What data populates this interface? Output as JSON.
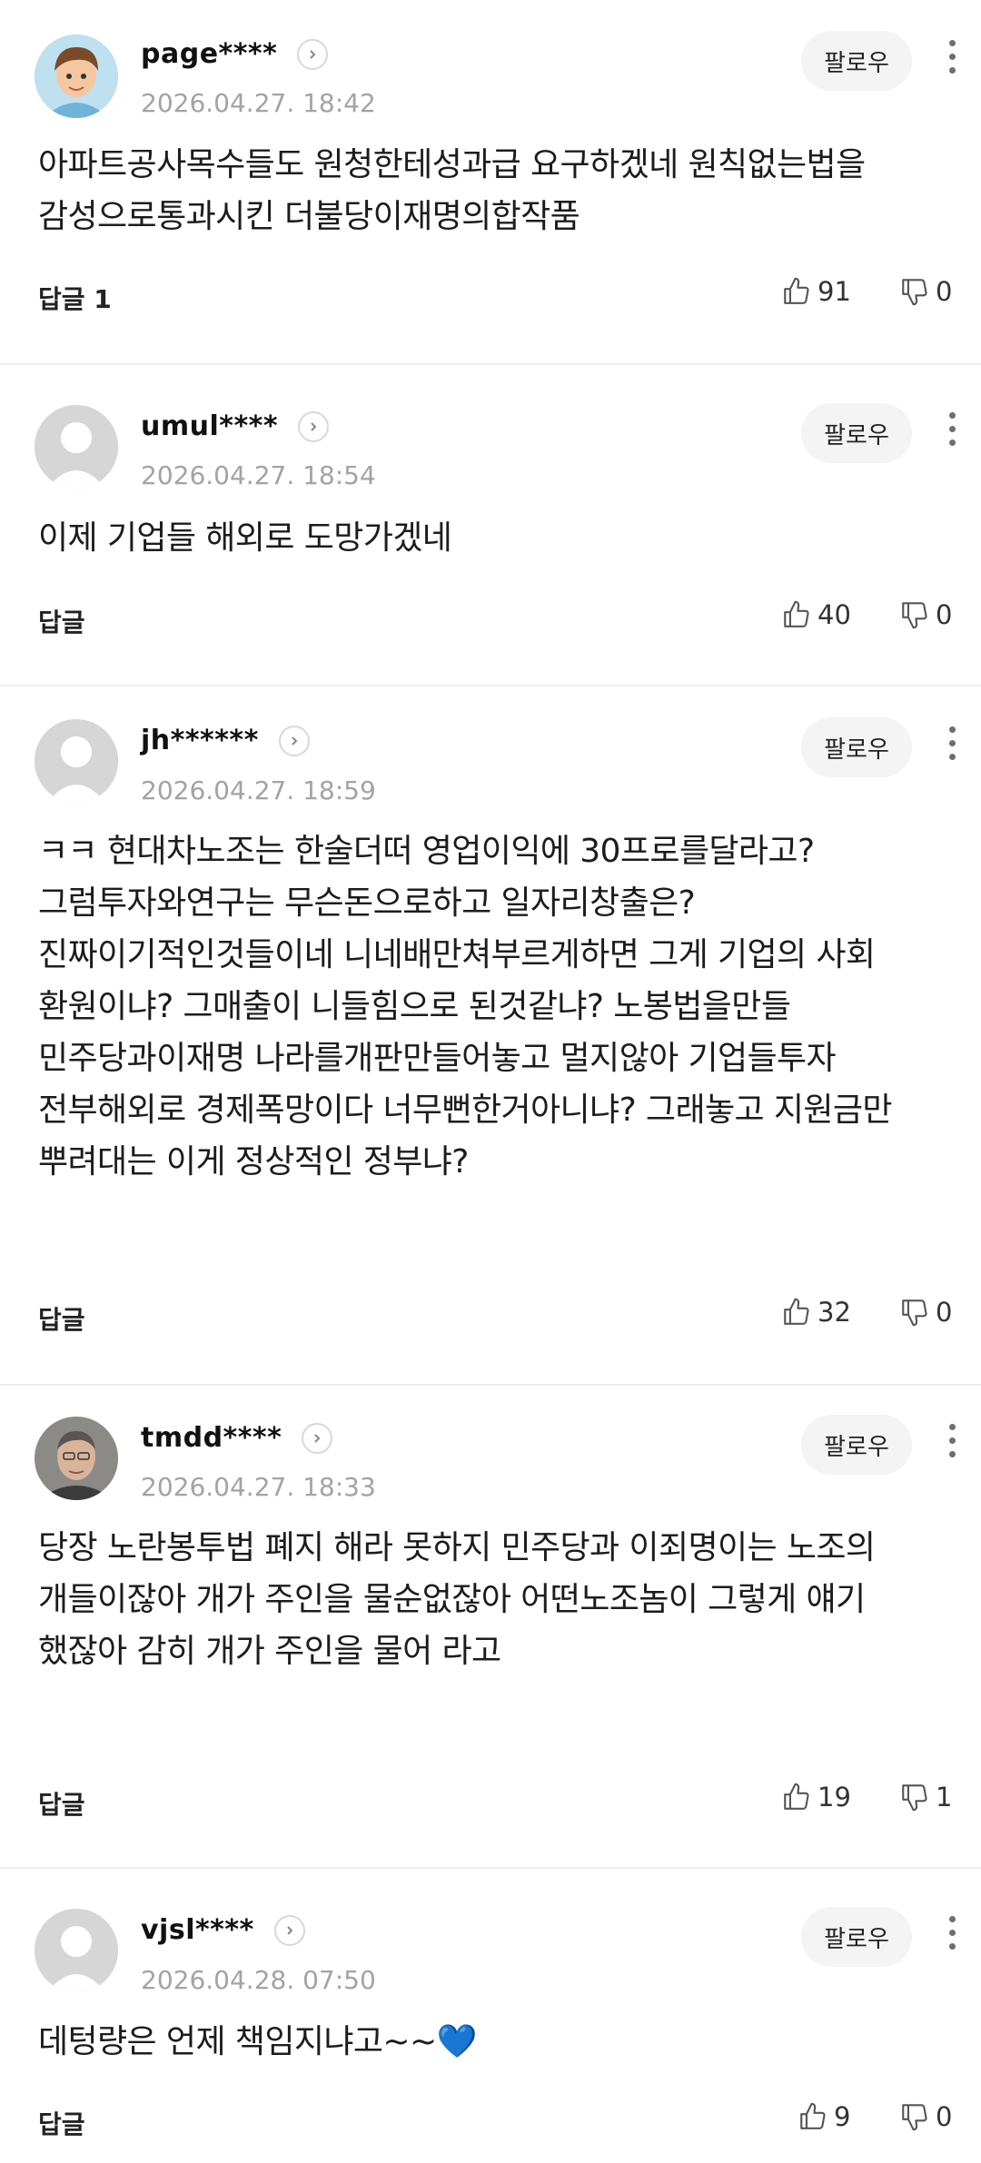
{
  "follow_label": "팔로우",
  "comments": [
    {
      "nickname": "page****",
      "date": "2026.04.27. 18:42",
      "text": "아파트공사목수들도 원청한테성과급 요구하겠네 원칙없는법을 감성으로통과시킨 더불당이재명의합작품",
      "reply_label": "답글 1",
      "likes": "91",
      "dislikes": "0",
      "avatar": "cartoon-avatar"
    },
    {
      "nickname": "umul****",
      "date": "2026.04.27. 18:54",
      "text": "이제 기업들 해외로 도망가겠네",
      "reply_label": "답글",
      "likes": "40",
      "dislikes": "0",
      "avatar": "default-avatar"
    },
    {
      "nickname": "jh******",
      "date": "2026.04.27. 18:59",
      "text": "ㅋㅋ 현대차노조는 한술더떠 영업이익에 30프로를달라고? 그럼투자와연구는 무슨돈으로하고 일자리창출은? 진짜이기적인것들이네 니네배만쳐부르게하면 그게 기업의 사회 환원이냐? 그매출이 니들힘으로 된것같냐? 노봉법을만들 민주당과이재명 나라를개판만들어놓고 멀지않아 기업들투자 전부해외로 경제폭망이다 너무뻔한거아니냐? 그래놓고 지원금만 뿌려대는 이게 정상적인 정부냐?",
      "reply_label": "답글",
      "likes": "32",
      "dislikes": "0",
      "avatar": "default-avatar"
    },
    {
      "nickname": "tmdd****",
      "date": "2026.04.27. 18:33",
      "text": "당장 노란봉투법 폐지 해라 못하지 민주당과 이죄명이는 노조의 개들이잖아 개가 주인을 물순없잖아 어떤노조놈이 그렇게 얘기 했잖아 감히 개가 주인을 물어 라고",
      "reply_label": "답글",
      "likes": "19",
      "dislikes": "1",
      "avatar": "photo-avatar"
    },
    {
      "nickname": "vjsl****",
      "date": "2026.04.28. 07:50",
      "text": "데텅량은 언제 책임지냐고~~💙",
      "reply_label": "답글",
      "likes": "9",
      "dislikes": "0",
      "avatar": "default-avatar"
    }
  ],
  "icons": {
    "like": "thumbs-up-icon",
    "dislike": "thumbs-down-icon",
    "more": "more-vertical-icon",
    "chevron": "chevron-right-icon"
  },
  "colors": {
    "date": "#a3a3a3",
    "follow_bg": "#f4f4f4",
    "divider": "#eeeeee"
  }
}
